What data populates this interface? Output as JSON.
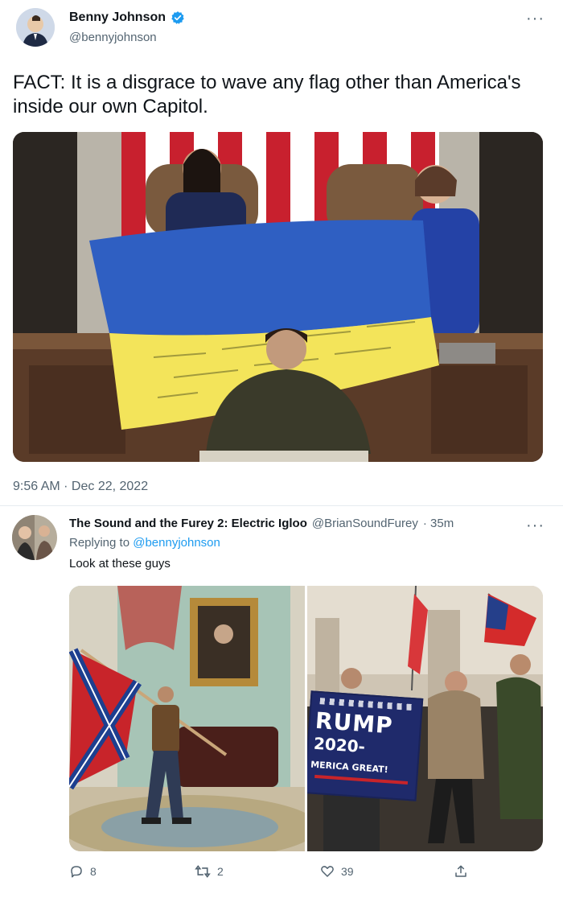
{
  "tweet": {
    "author": {
      "name": "Benny Johnson",
      "handle": "@bennyjohnson",
      "verified": true
    },
    "text": "FACT: It is a disgrace to wave any flag other than America's inside our own Capitol.",
    "timestamp": "9:56 AM · Dec 22, 2022",
    "more_label": "···"
  },
  "reply": {
    "author": {
      "name": "The Sound and the Furey 2: Electric Igloo",
      "handle": "@BrianSoundFurey",
      "time": "· 35m"
    },
    "replying_prefix": "Replying to",
    "replying_to": "@bennyjohnson",
    "text": "Look at these guys",
    "more_label": "···",
    "banner": {
      "line1": "RUMP",
      "line2": "2020-",
      "line3": "MERICA GREAT!"
    }
  },
  "actions": {
    "replies": "8",
    "retweets": "2",
    "likes": "39"
  },
  "colors": {
    "accent": "#1d9bf0",
    "flag_blue": "#2f5fc2",
    "flag_yellow": "#f3e45a"
  }
}
